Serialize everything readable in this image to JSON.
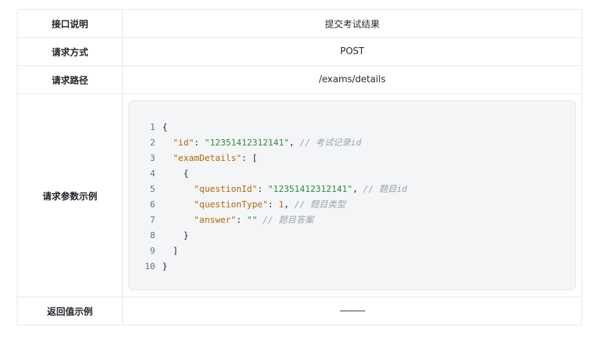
{
  "rows": [
    {
      "key": "接口说明",
      "value": "提交考试结果"
    },
    {
      "key": "请求方式",
      "value": "POST"
    },
    {
      "key": "请求路径",
      "value": "/exams/details"
    },
    {
      "key": "请求参数示例"
    },
    {
      "key": "返回值示例",
      "value": "———"
    }
  ],
  "code": {
    "line_numbers": [
      "1",
      "2",
      "3",
      "4",
      "5",
      "6",
      "7",
      "8",
      "9",
      "10"
    ],
    "lines": [
      {
        "t": "{"
      },
      {
        "indent": "  ",
        "key": "\"id\"",
        "sep": ": ",
        "str": "\"12351412312141\"",
        "after": ", ",
        "cmt": "// 考试记录id"
      },
      {
        "indent": "  ",
        "key": "\"examDetails\"",
        "sep": ": [",
        "str": "",
        "after": "",
        "cmt": ""
      },
      {
        "t": "    {"
      },
      {
        "indent": "      ",
        "key": "\"questionId\"",
        "sep": ": ",
        "str": "\"12351412312141\"",
        "after": ", ",
        "cmt": "// 题目id"
      },
      {
        "indent": "      ",
        "key": "\"questionType\"",
        "sep": ": ",
        "num": "1",
        "after": ", ",
        "cmt": "// 题目类型"
      },
      {
        "indent": "      ",
        "key": "\"answer\"",
        "sep": ": ",
        "str": "\"\"",
        "after": " ",
        "cmt": "// 题目答案"
      },
      {
        "t": "    }"
      },
      {
        "t": "  ]"
      },
      {
        "t": "}"
      }
    ]
  }
}
